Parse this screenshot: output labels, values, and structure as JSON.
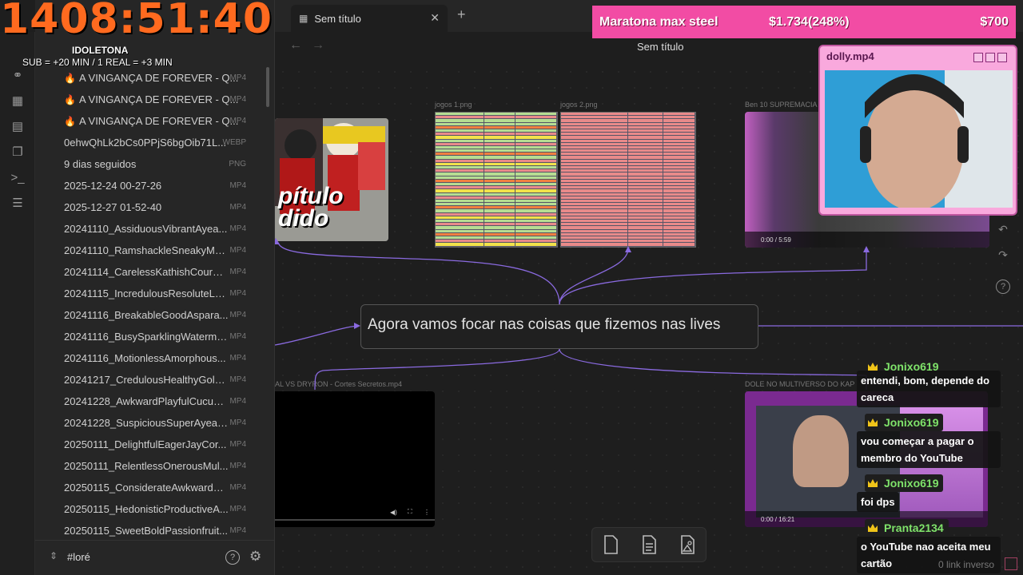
{
  "overlay": {
    "timer": "1408:51:40",
    "streamer": "IDOLETONA",
    "sub_rule": "SUB = +20  MIN / 1 REAL = +3 MIN"
  },
  "tabs": [
    {
      "title": "Sem título"
    }
  ],
  "view_title": "Sem título",
  "files": [
    {
      "name": "A VINGANÇA DE FOREVER - Q...",
      "ext": "MP4",
      "fire": true
    },
    {
      "name": "A VINGANÇA DE FOREVER - Q...",
      "ext": "MP4",
      "fire": true
    },
    {
      "name": "A VINGANÇA DE FOREVER - Q...",
      "ext": "MP4",
      "fire": true
    },
    {
      "name": "0ehwQhLk2bCs0PPjS6bgOib71L...",
      "ext": "WEBP",
      "fire": false
    },
    {
      "name": "9 dias seguidos",
      "ext": "PNG",
      "fire": false
    },
    {
      "name": "2025-12-24 00-27-26",
      "ext": "MP4",
      "fire": false
    },
    {
      "name": "2025-12-27 01-52-40",
      "ext": "MP4",
      "fire": false
    },
    {
      "name": "20241110_AssiduousVibrantAyea...",
      "ext": "MP4",
      "fire": false
    },
    {
      "name": "20241110_RamshackleSneakyMos...",
      "ext": "MP4",
      "fire": false
    },
    {
      "name": "20241114_CarelessKathishCourge...",
      "ext": "MP4",
      "fire": false
    },
    {
      "name": "20241115_IncredulousResoluteLe...",
      "ext": "MP4",
      "fire": false
    },
    {
      "name": "20241116_BreakableGoodAspara...",
      "ext": "MP4",
      "fire": false
    },
    {
      "name": "20241116_BusySparklingWaterme...",
      "ext": "MP4",
      "fire": false
    },
    {
      "name": "20241116_MotionlessAmorphous...",
      "ext": "MP4",
      "fire": false
    },
    {
      "name": "20241217_CredulousHealthyGold...",
      "ext": "MP4",
      "fire": false
    },
    {
      "name": "20241228_AwkwardPlayfulCucum...",
      "ext": "MP4",
      "fire": false
    },
    {
      "name": "20241228_SuspiciousSuperAyeay...",
      "ext": "MP4",
      "fire": false
    },
    {
      "name": "20250111_DelightfulEagerJayCor...",
      "ext": "MP4",
      "fire": false
    },
    {
      "name": "20250111_RelentlessOnerousMul...",
      "ext": "MP4",
      "fire": false
    },
    {
      "name": "20250115_ConsiderateAwkwardO...",
      "ext": "MP4",
      "fire": false
    },
    {
      "name": "20250115_HedonisticProductiveA...",
      "ext": "MP4",
      "fire": false
    },
    {
      "name": "20250115_SweetBoldPassionfruit...",
      "ext": "MP4",
      "fire": false
    }
  ],
  "vault_name": "#loré",
  "canvas": {
    "central_text": "Agora vamos focar nas coisas que fizemos nas lives",
    "labels": {
      "jogos1": "jogos 1.png",
      "jogos2": "jogos 2.png",
      "ben10": "Ben 10 SUPREMACIA",
      "cortes": "AL VS DRYRON - Cortes Secretos.mp4",
      "dole": "DOLE NO MULTIVERSO DO KAP"
    },
    "thumb_text": "pítulo\ndido",
    "video_time_ben10": "0:00 / 5:59",
    "video_time_dole": "0:00 / 16:21"
  },
  "donation": {
    "title": "Maratona max steel",
    "progress": "$1.734(248%)",
    "goal": "$700"
  },
  "webcam": {
    "title": "dolly.mp4"
  },
  "chat": [
    {
      "user": "Jonixo619",
      "msg": "entendi, bom, depende do careca"
    },
    {
      "user": "Jonixo619",
      "msg": "vou começar a pagar o membro do YouTube"
    },
    {
      "user": "Jonixo619",
      "msg": "foi dps"
    },
    {
      "user": "Pranta2134",
      "msg": "o YouTube nao aceita meu cartão"
    }
  ],
  "link_inverso": "0 link inverso"
}
